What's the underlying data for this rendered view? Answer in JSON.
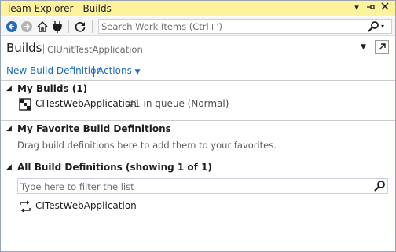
{
  "window": {
    "title": "Team Explorer - Builds",
    "title_buttons": [
      "dropdown-icon",
      "pin-icon",
      "close-icon"
    ]
  },
  "toolbar": {
    "buttons": [
      "back-icon",
      "forward-icon",
      "home-icon",
      "connect-icon",
      "refresh-icon"
    ],
    "search_placeholder": "Search Work Items (Ctrl+')"
  },
  "header": {
    "title": "Builds",
    "project": "CIUnitTestApplication"
  },
  "actions": {
    "new_build_definition": "New Build Definition",
    "actions_label": "Actions"
  },
  "sections": {
    "my_builds": {
      "title": "My Builds (1)",
      "items": [
        {
          "name": "CITestWebApplication",
          "status": "#1 in queue (Normal)"
        }
      ]
    },
    "favorites": {
      "title": "My Favorite Build Definitions",
      "hint": "Drag build definitions here to add them to your favorites."
    },
    "all_definitions": {
      "title": "All Build Definitions (showing 1 of 1)",
      "filter_placeholder": "Type here to filter the list",
      "items": [
        {
          "name": "CITestWebApplication"
        }
      ]
    }
  },
  "colors": {
    "title_bar": "#fff29d",
    "link": "#1e6bbf",
    "back_button": "#1e6bbf"
  }
}
